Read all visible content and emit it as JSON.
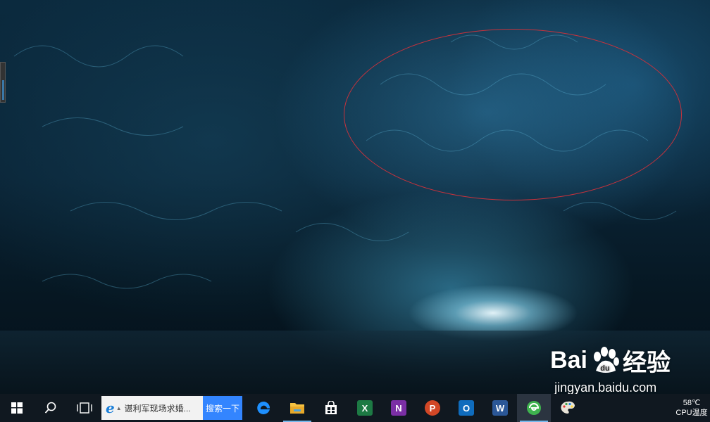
{
  "taskbar": {
    "search_box": {
      "text": "谌利军现场求婚...",
      "button_label": "搜索一下"
    },
    "apps": [
      {
        "name": "edge",
        "color": "#1e90ff"
      },
      {
        "name": "file-explorer",
        "color": "#f5c242"
      },
      {
        "name": "store",
        "color": "#ffffff"
      },
      {
        "name": "excel",
        "letter": "X",
        "color": "#1d7a44"
      },
      {
        "name": "onenote",
        "letter": "N",
        "color": "#7b2fa5"
      },
      {
        "name": "powerpoint",
        "letter": "P",
        "color": "#d24726"
      },
      {
        "name": "outlook",
        "letter": "O",
        "color": "#0f6cbd"
      },
      {
        "name": "word",
        "letter": "W",
        "color": "#2b5797"
      },
      {
        "name": "360-browser",
        "color": "#3fb34f"
      }
    ],
    "tray": {
      "temperature": "58℃",
      "temperature_label": "CPU温度"
    }
  },
  "watermark": {
    "brand": "Bai",
    "brand_suffix": "经验",
    "url": "jingyan.baidu.com"
  }
}
